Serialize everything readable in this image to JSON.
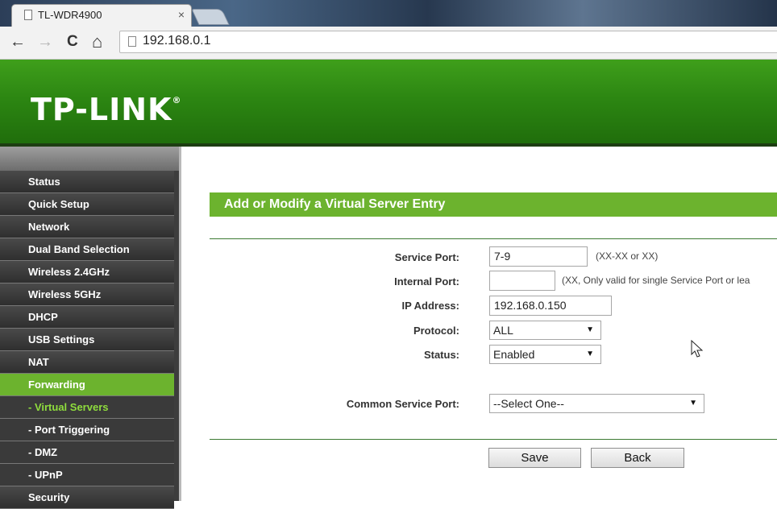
{
  "browser": {
    "tab_title": "TL-WDR4900",
    "tab_close": "×",
    "back": "←",
    "forward": "→",
    "reload": "C",
    "home": "⌂",
    "url": "192.168.0.1"
  },
  "header": {
    "logo": "TP-LINK",
    "logo_mark": "®",
    "color": "#2c8612"
  },
  "sidebar": {
    "items": [
      {
        "label": "Status"
      },
      {
        "label": "Quick Setup"
      },
      {
        "label": "Network"
      },
      {
        "label": "Dual Band Selection"
      },
      {
        "label": "Wireless 2.4GHz"
      },
      {
        "label": "Wireless 5GHz"
      },
      {
        "label": "DHCP"
      },
      {
        "label": "USB Settings"
      },
      {
        "label": "NAT"
      },
      {
        "label": "Forwarding"
      },
      {
        "label": "- Virtual Servers"
      },
      {
        "label": "- Port Triggering"
      },
      {
        "label": "- DMZ"
      },
      {
        "label": "- UPnP"
      },
      {
        "label": "Security"
      }
    ],
    "active": "Forwarding",
    "selected_sub": "- Virtual Servers",
    "accent": "#6cb32e"
  },
  "main": {
    "title": "Add or Modify a Virtual Server Entry",
    "service_port": {
      "label": "Service Port:",
      "value": "7-9",
      "hint": "(XX-XX or XX)"
    },
    "internal_port": {
      "label": "Internal Port:",
      "value": "",
      "hint": "(XX, Only valid for single Service Port or lea"
    },
    "ip_address": {
      "label": "IP Address:",
      "value": "192.168.0.150"
    },
    "protocol": {
      "label": "Protocol:",
      "value": "ALL"
    },
    "status": {
      "label": "Status:",
      "value": "Enabled"
    },
    "common_service_port": {
      "label": "Common Service Port:",
      "value": "--Select One--"
    },
    "save_label": "Save",
    "back_label": "Back"
  }
}
